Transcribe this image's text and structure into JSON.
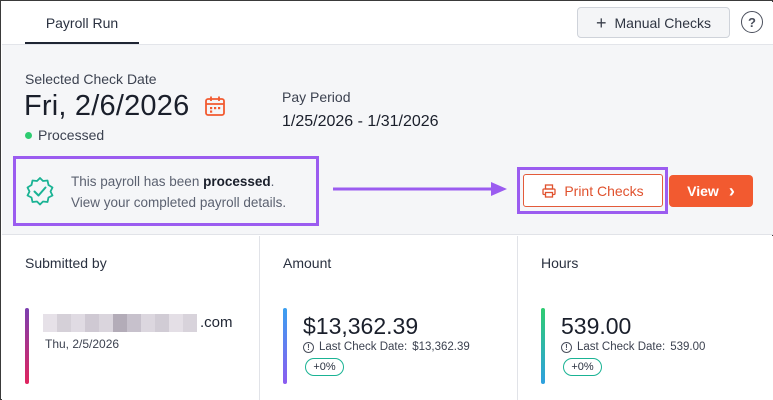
{
  "header": {
    "tab_label": "Payroll Run",
    "manual_checks_label": "Manual Checks",
    "help_glyph": "?"
  },
  "check_date": {
    "label": "Selected Check Date",
    "value": "Fri, 2/6/2026",
    "status": "Processed"
  },
  "pay_period": {
    "label": "Pay Period",
    "value": "1/25/2026 - 1/31/2026"
  },
  "notice": {
    "line1_prefix": "This payroll has been ",
    "line1_bold": "processed",
    "line1_suffix": ".",
    "line2": "View your completed payroll details."
  },
  "actions": {
    "print_checks_label": "Print Checks",
    "view_label": "View",
    "view_chevron": "›"
  },
  "cards": {
    "submitted": {
      "title": "Submitted by",
      "email_suffix": ".com",
      "date": "Thu, 2/5/2026"
    },
    "amount": {
      "title": "Amount",
      "value": "$13,362.39",
      "last_check_label": "Last Check Date:",
      "last_check_value": "$13,362.39",
      "change": "+0%"
    },
    "hours": {
      "title": "Hours",
      "value": "539.00",
      "last_check_label": "Last Check Date:",
      "last_check_value": "539.00",
      "change": "+0%"
    }
  },
  "colors": {
    "accent_orange": "#f25a30",
    "highlight_purple": "#9b5cf0",
    "status_green": "#2ecc71",
    "badge_teal": "#1ab394"
  },
  "icons": [
    "plus-icon",
    "help-icon",
    "calendar-icon",
    "check-badge-icon",
    "arrow-right-icon",
    "printer-icon",
    "chevron-right-icon",
    "info-icon"
  ]
}
